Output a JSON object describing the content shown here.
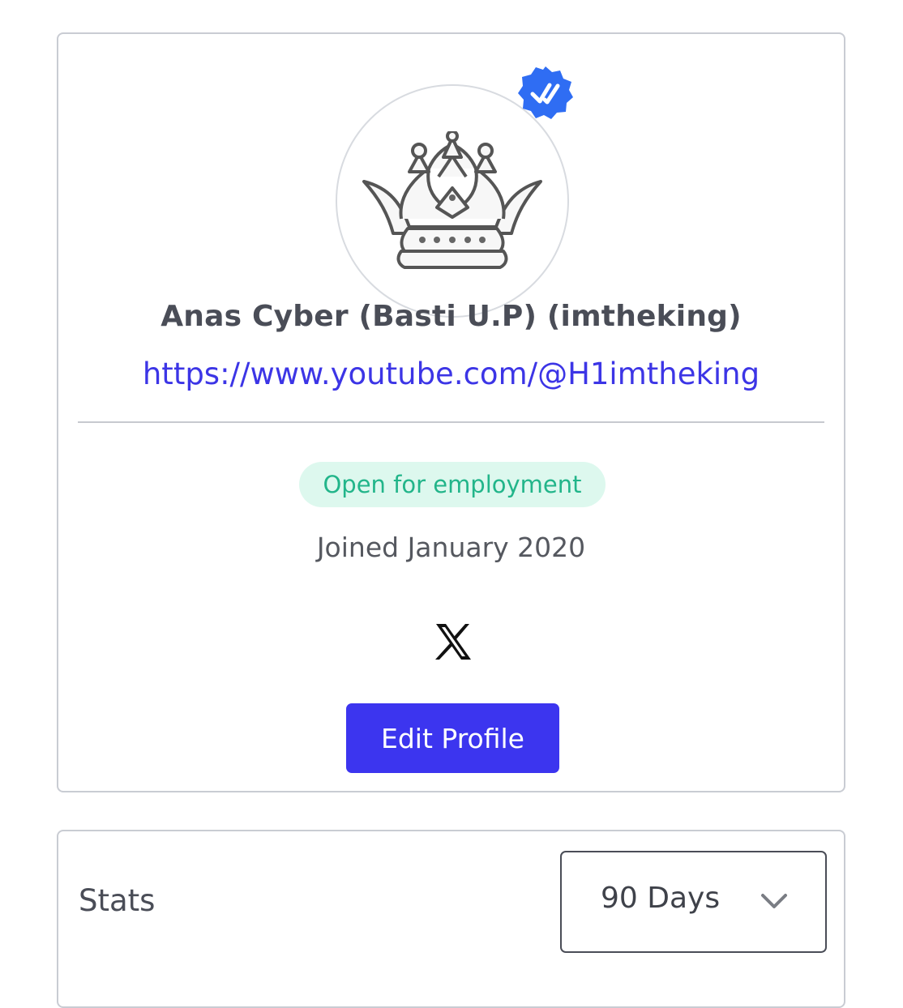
{
  "profile": {
    "name": "Anas Cyber (Basti U.P) (imtheking)",
    "link": "https://www.youtube.com/@H1imtheking",
    "status_badge": "Open for employment",
    "joined": "Joined January 2020",
    "edit_button": "Edit Profile",
    "verified_icon": "verified-badge-icon",
    "social_icon": "x-logo-icon",
    "avatar_icon": "crown-avatar"
  },
  "stats": {
    "title": "Stats",
    "period_select": "90 Days"
  },
  "colors": {
    "accent": "#3c35ef",
    "link": "#3c35e6",
    "status_bg": "#ddf8ee",
    "status_text": "#22b58a",
    "verified": "#2f6df3"
  }
}
